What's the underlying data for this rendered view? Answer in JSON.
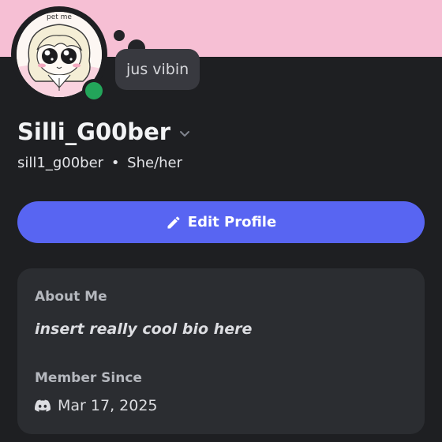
{
  "profile": {
    "avatar_caption": "pet me",
    "avatar_icon": "chibi-character-avatar",
    "status_color": "#23a55a",
    "custom_status": "jus vibin",
    "display_name": "Silli_G00ber",
    "username": "sill1_g00ber",
    "separator": "•",
    "pronouns": "She/her",
    "banner_color": "#f6bfd4"
  },
  "actions": {
    "edit_profile_label": "Edit Profile",
    "edit_icon": "pencil-icon",
    "accent_color": "#5865f2"
  },
  "about": {
    "heading": "About Me",
    "bio": "insert really cool bio here",
    "member_since_heading": "Member Since",
    "member_since_icon": "discord-logo-icon",
    "member_since_date": "Mar 17, 2025"
  }
}
